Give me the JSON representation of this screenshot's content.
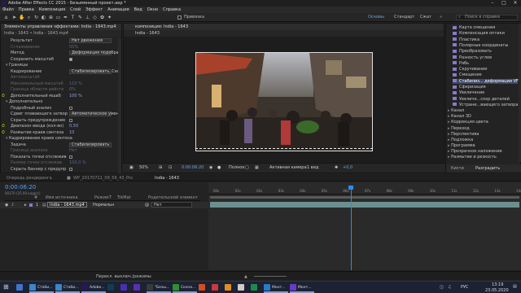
{
  "title": "Adobe After Effects CC 2015 - Безымянный проект.aep *",
  "window_controls": {
    "minimize": "–",
    "maximize": "□",
    "close": "✕"
  },
  "menu": [
    "Файл",
    "Правка",
    "Композиция",
    "Слой",
    "Эффект",
    "Анимация",
    "Вид",
    "Окно",
    "Справка"
  ],
  "toolbar": {
    "snap_label": "Привязка",
    "workspaces": [
      "Основы",
      "Стандарт",
      "Сжат"
    ],
    "search_placeholder": "Поиск в справке"
  },
  "effects_panel": {
    "tab": "Элементы управления эффектами: India - 1643.mp4",
    "breadcrumb": "India - 1643 • India - 1643.mp4",
    "rows": [
      {
        "kind": "sel",
        "label": "Результат",
        "value": "Нет движения",
        "dim": false
      },
      {
        "kind": "val",
        "label": "Сглаживание",
        "value": "50%",
        "dim": true
      },
      {
        "kind": "sel",
        "label": "Метод",
        "value": "Деформация подобраст",
        "dim": false
      },
      {
        "kind": "chk",
        "label": "Сохранить масштаб",
        "value": "",
        "dim": false
      },
      {
        "kind": "head",
        "label": "Границы",
        "value": "",
        "dim": false
      },
      {
        "kind": "sel",
        "label": "Кадрирование",
        "value": "Стабилизировать, Сен",
        "dim": false
      },
      {
        "kind": "val",
        "label": "Автомасштаб",
        "value": "",
        "dim": true
      },
      {
        "kind": "val",
        "label": "Максимальный масштаб",
        "value": "110 %",
        "dim": true
      },
      {
        "kind": "val",
        "label": "Граница области действ",
        "value": "0%",
        "dim": true
      },
      {
        "kind": "val",
        "label": "Дополнительный мшаб",
        "value": "100 %",
        "dim": false
      },
      {
        "kind": "head",
        "label": "Дополнительно",
        "value": "",
        "dim": false
      },
      {
        "kind": "chk",
        "label": "Подробный анализ",
        "value": "",
        "dim": false
      },
      {
        "kind": "sel",
        "label": "Сдвиг плавающего затвор",
        "value": "Автоматическое умень",
        "dim": false
      },
      {
        "kind": "chk",
        "label": "Скрыть предупреждение",
        "value": "",
        "dim": false
      },
      {
        "kind": "val",
        "label": "Диапазон ввода (кол-во)",
        "value": "0,50",
        "dim": false
      },
      {
        "kind": "val",
        "label": "Размытие краев синтеза",
        "value": "10",
        "dim": false
      },
      {
        "kind": "head",
        "label": "Кадрирование краев синтеза",
        "value": "",
        "dim": false
      },
      {
        "kind": "sel",
        "label": "Задача",
        "value": "Стабилизировать",
        "dim": false
      },
      {
        "kind": "val",
        "label": "Граница анализа",
        "value": "Нет",
        "dim": true
      },
      {
        "kind": "chk",
        "label": "Показать точки отслежив",
        "value": "",
        "dim": false
      },
      {
        "kind": "val",
        "label": "Размер точки отслежив.",
        "value": "100,0 %",
        "dim": true
      },
      {
        "kind": "chk",
        "label": "Скрыть баннер с предупр",
        "value": "",
        "dim": false
      }
    ]
  },
  "comp_panel": {
    "tab": "композиция: India - 1643",
    "subtab": "India - 1643",
    "zoom": "50%",
    "timecode": "0:00:06:20",
    "resolution": "Полное",
    "camera": "Активная камера",
    "views": "1 вид",
    "exposure": "+0,0"
  },
  "fx_panel": {
    "items": [
      "Карта смещения",
      "Компенсация оптики",
      "Пластика",
      "Полярные координаты",
      "Преобразовать",
      "Разность углов",
      "Рябь",
      "Скручивание",
      "Смещение",
      "Стабилиз... деформации VFX",
      "Сферизация",
      "Увеличение",
      "Увеличе...сохр деталей",
      "Устрани...вающего затвора"
    ],
    "highlighted_index": 9,
    "categories": [
      "Канал",
      "Канал 3D",
      "Коррекция цвета",
      "Переход",
      "Перспектива",
      "Подложка",
      "Программа",
      "Прозрачное наложение",
      "Размытие и резкость"
    ],
    "tabs": [
      "Кисти",
      "Разградить"
    ]
  },
  "render_tab": "Очередь рендеринга",
  "project_tab": "WP_20170711_09_56_43_Pro",
  "timeline": {
    "tab": "India - 1643",
    "timecode": "0:00:06:20",
    "frame_info": "00170 (25.00 кадр/с)",
    "columns": [
      "#",
      "Имя источника",
      "Режим",
      "T",
      "TrkMat",
      "Родительский элемент"
    ],
    "layer": {
      "number": "1",
      "name": "India - 1643.mp4",
      "mode": "Нормальн",
      "parent": "Нет"
    },
    "ruler": [
      "00s",
      "01s",
      "02s",
      "03s",
      "04s",
      "05s",
      "06s",
      "07s",
      "08s",
      "09s",
      "10s",
      "11s",
      "12s",
      "13s",
      "14s"
    ],
    "playhead_fraction": 0.455
  },
  "status": "Перекл. выключ./режимы",
  "taskbar": {
    "apps": [
      {
        "label": "",
        "color": "#3f74c9"
      },
      {
        "label": "Стаби...",
        "color": "#3a86c9"
      },
      {
        "label": "Стаби...",
        "color": "#3a86c9"
      },
      {
        "label": "Adobe...",
        "color": "#2b1852"
      },
      {
        "label": "",
        "color": "#0f3d53"
      },
      {
        "label": "",
        "color": "#4a2fb0"
      },
      {
        "label": "",
        "color": "#5b2fb0"
      },
      {
        "label": "\"Безы...",
        "color": "#3a3a3a"
      },
      {
        "label": "Скача...",
        "color": "#2f8f2f"
      },
      {
        "label": "",
        "color": "#d84b20"
      },
      {
        "label": "",
        "color": "#c73b3b"
      },
      {
        "label": "",
        "color": "#e58a1e"
      },
      {
        "label": "",
        "color": "#ccc"
      },
      {
        "label": "",
        "color": "#1e8a4a"
      },
      {
        "label": "Монт...",
        "color": "#2a7ac8"
      },
      {
        "label": "Монт...",
        "color": "#6a3ac8"
      }
    ],
    "lang": "РУС",
    "time": "13:19",
    "date": "23.05.2020"
  },
  "colors": {
    "accent": "#2d8ceb",
    "playhead": "#2d8ceb",
    "track": "#6b8f8f",
    "label_purple": "#8a79c9"
  }
}
